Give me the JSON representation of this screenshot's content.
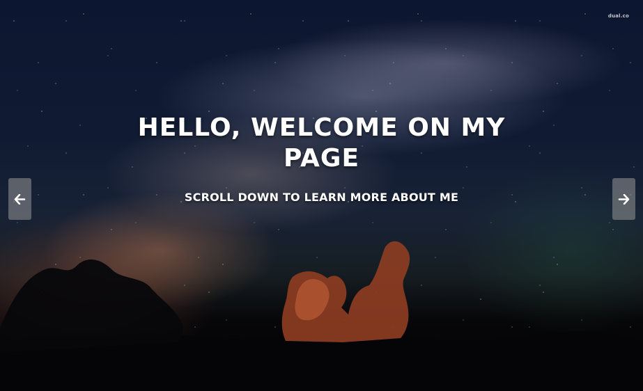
{
  "watermark": "dual.co",
  "hero": {
    "headline": "HELLO, WELCOME ON MY PAGE",
    "subheadline": "SCROLL DOWN TO LEARN MORE ABOUT ME"
  },
  "carousel": {
    "prev_icon": "arrow-left-icon",
    "next_icon": "arrow-right-icon"
  },
  "colors": {
    "text": "#ffffff",
    "nav_bg": "rgba(150,150,150,0.55)"
  }
}
